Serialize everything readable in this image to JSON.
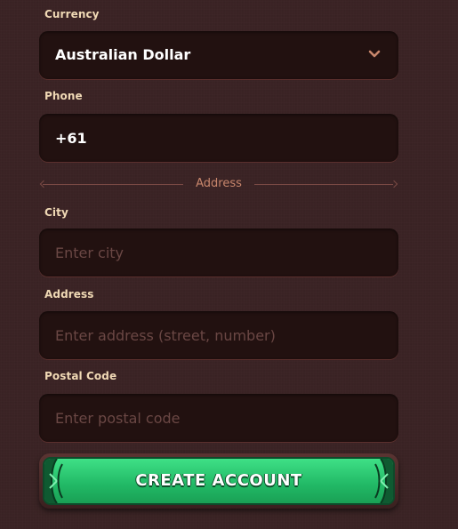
{
  "form": {
    "currency": {
      "label": "Currency",
      "selected": "Australian Dollar"
    },
    "phone": {
      "label": "Phone",
      "value": "+61"
    },
    "address_section": {
      "title": "Address"
    },
    "city": {
      "label": "City",
      "placeholder": "Enter city"
    },
    "address": {
      "label": "Address",
      "placeholder": "Enter address (street, number)"
    },
    "postal_code": {
      "label": "Postal Code",
      "placeholder": "Enter postal code"
    },
    "submit_label": "CREATE ACCOUNT"
  },
  "icons": {
    "select_chevron": "chevron-down-icon"
  },
  "colors": {
    "background": "#3a2324",
    "field_bg": "#221110",
    "label": "#f0d9b5",
    "placeholder": "#6a4744",
    "accent_orange": "#c8866c",
    "button_green": "#21b865"
  }
}
